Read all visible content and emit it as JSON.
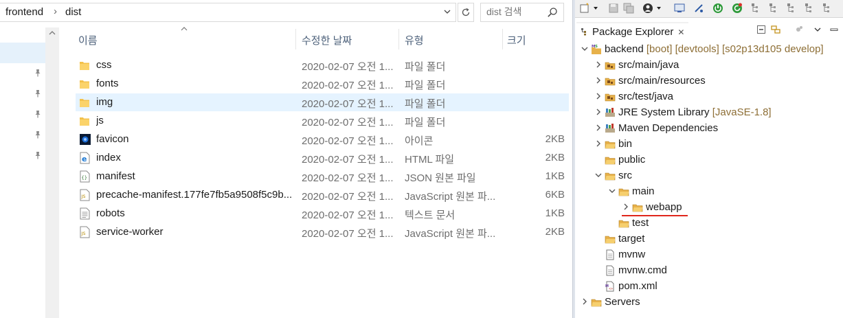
{
  "explorer": {
    "breadcrumb": [
      "frontend",
      "dist"
    ],
    "breadcrumb_sep": "›",
    "search": {
      "placeholder": "dist 검색"
    },
    "columns": {
      "name": "이름",
      "date": "수정한 날짜",
      "type": "유형",
      "size": "크기"
    },
    "files": [
      {
        "name": "css",
        "date": "2020-02-07 오전 1...",
        "type": "파일 폴더",
        "size": "",
        "icon": "folder-icon"
      },
      {
        "name": "fonts",
        "date": "2020-02-07 오전 1...",
        "type": "파일 폴더",
        "size": "",
        "icon": "folder-icon"
      },
      {
        "name": "img",
        "date": "2020-02-07 오전 1...",
        "type": "파일 폴더",
        "size": "",
        "icon": "folder-icon",
        "selected": true
      },
      {
        "name": "js",
        "date": "2020-02-07 오전 1...",
        "type": "파일 폴더",
        "size": "",
        "icon": "folder-icon"
      },
      {
        "name": "favicon",
        "date": "2020-02-07 오전 1...",
        "type": "아이콘",
        "size": "2KB",
        "icon": "favicon-image-icon"
      },
      {
        "name": "index",
        "date": "2020-02-07 오전 1...",
        "type": "HTML 파일",
        "size": "2KB",
        "icon": "html-file-icon"
      },
      {
        "name": "manifest",
        "date": "2020-02-07 오전 1...",
        "type": "JSON 원본 파일",
        "size": "1KB",
        "icon": "json-file-icon"
      },
      {
        "name": "precache-manifest.177fe7fb5a9508f5c9b...",
        "date": "2020-02-07 오전 1...",
        "type": "JavaScript 원본 파...",
        "size": "6KB",
        "icon": "js-file-icon"
      },
      {
        "name": "robots",
        "date": "2020-02-07 오전 1...",
        "type": "텍스트 문서",
        "size": "1KB",
        "icon": "text-file-icon"
      },
      {
        "name": "service-worker",
        "date": "2020-02-07 오전 1...",
        "type": "JavaScript 원본 파...",
        "size": "2KB",
        "icon": "js-file-icon"
      }
    ]
  },
  "eclipse": {
    "view_title": "Package Explorer",
    "view_close": "✕",
    "tree": [
      {
        "label": "backend",
        "decoration": "[boot] [devtools] [s02p13d105 develop]",
        "twisty": "expanded",
        "icon": "maven-project-icon",
        "level": 0
      },
      {
        "label": "src/main/java",
        "decoration": "",
        "twisty": "collapsed",
        "icon": "source-folder-icon",
        "level": 1
      },
      {
        "label": "src/main/resources",
        "decoration": "",
        "twisty": "collapsed",
        "icon": "source-folder-icon",
        "level": 1
      },
      {
        "label": "src/test/java",
        "decoration": "",
        "twisty": "collapsed",
        "icon": "source-folder-icon",
        "level": 1
      },
      {
        "label": "JRE System Library",
        "decoration": "[JavaSE-1.8]",
        "twisty": "collapsed",
        "icon": "library-icon",
        "level": 1
      },
      {
        "label": "Maven Dependencies",
        "decoration": "",
        "twisty": "collapsed",
        "icon": "library-icon",
        "level": 1
      },
      {
        "label": "bin",
        "decoration": "",
        "twisty": "collapsed",
        "icon": "folder-icon",
        "level": 1
      },
      {
        "label": "public",
        "decoration": "",
        "twisty": "none",
        "icon": "folder-icon",
        "level": 1
      },
      {
        "label": "src",
        "decoration": "",
        "twisty": "expanded",
        "icon": "folder-icon",
        "level": 1
      },
      {
        "label": "main",
        "decoration": "",
        "twisty": "expanded",
        "icon": "folder-icon",
        "level": 2
      },
      {
        "label": "webapp",
        "decoration": "",
        "twisty": "collapsed",
        "icon": "folder-icon",
        "level": 3
      },
      {
        "label": "test",
        "decoration": "",
        "twisty": "none",
        "icon": "folder-icon",
        "level": 2
      },
      {
        "label": "target",
        "decoration": "",
        "twisty": "none",
        "icon": "folder-icon",
        "level": 1
      },
      {
        "label": "mvnw",
        "decoration": "",
        "twisty": "none",
        "icon": "file-icon",
        "level": 1
      },
      {
        "label": "mvnw.cmd",
        "decoration": "",
        "twisty": "none",
        "icon": "file-icon",
        "level": 1
      },
      {
        "label": "pom.xml",
        "decoration": "",
        "twisty": "none",
        "icon": "xml-file-icon",
        "level": 1
      },
      {
        "label": "Servers",
        "decoration": "",
        "twisty": "collapsed",
        "icon": "folder-icon",
        "level": 0
      }
    ]
  },
  "colors": {
    "selected_row": "#e5f3ff",
    "highlight_underline": "#e0261b",
    "folder": "#f3c14b",
    "decoration": "#8d6e35"
  }
}
